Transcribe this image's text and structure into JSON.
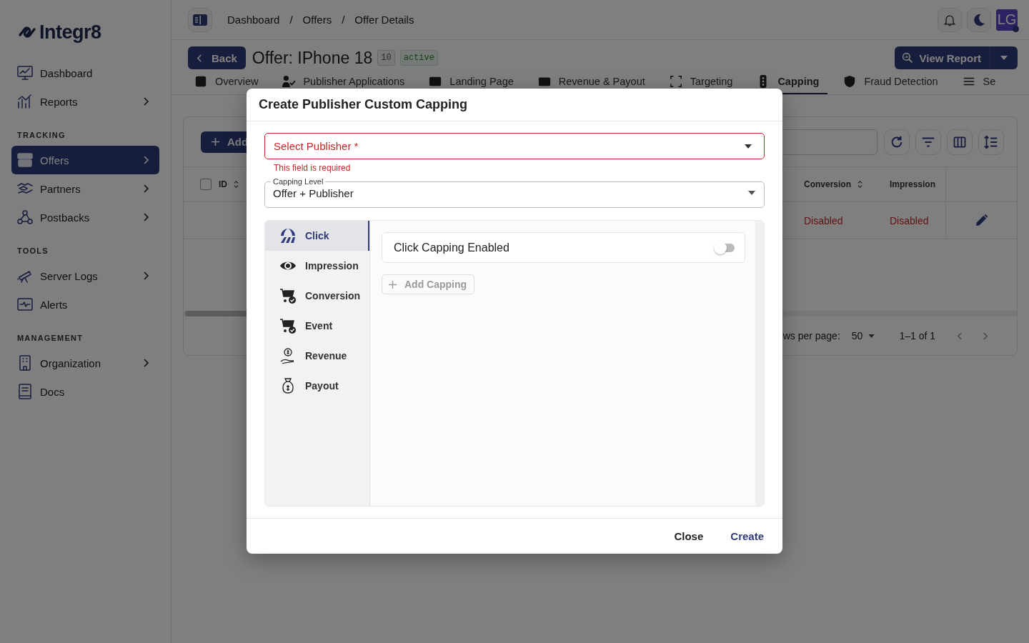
{
  "sidebar": {
    "logo": "Integr8",
    "sections": [
      {
        "items": [
          {
            "label": "Dashboard",
            "expandable": false,
            "selected": false
          },
          {
            "label": "Reports",
            "expandable": true,
            "selected": false
          }
        ]
      },
      {
        "heading": "TRACKING",
        "items": [
          {
            "label": "Offers",
            "expandable": true,
            "selected": true
          },
          {
            "label": "Partners",
            "expandable": true,
            "selected": false
          },
          {
            "label": "Postbacks",
            "expandable": true,
            "selected": false
          }
        ]
      },
      {
        "heading": "TOOLS",
        "items": [
          {
            "label": "Server Logs",
            "expandable": true,
            "selected": false
          },
          {
            "label": "Alerts",
            "expandable": false,
            "selected": false
          }
        ]
      },
      {
        "heading": "MANAGEMENT",
        "items": [
          {
            "label": "Organization",
            "expandable": true,
            "selected": false
          },
          {
            "label": "Docs",
            "expandable": false,
            "selected": false
          }
        ]
      }
    ]
  },
  "breadcrumb": {
    "separator": "/",
    "items": [
      "Dashboard",
      "Offers",
      "Offer Details"
    ]
  },
  "avatar": "LG",
  "header": {
    "back": "Back",
    "title": "Offer: IPhone 18",
    "id": "10",
    "status": "active",
    "view_report": "View Report"
  },
  "tabs": [
    {
      "label": "Overview",
      "selected": false
    },
    {
      "label": "Publisher Applications",
      "selected": false
    },
    {
      "label": "Landing Page",
      "selected": false
    },
    {
      "label": "Revenue & Payout",
      "selected": false
    },
    {
      "label": "Targeting",
      "selected": false
    },
    {
      "label": "Capping",
      "selected": true
    },
    {
      "label": "Fraud Detection",
      "selected": false
    },
    {
      "label": "Se",
      "selected": false
    }
  ],
  "table": {
    "add_button": "Add",
    "all_checked": false,
    "columns": [
      "ID",
      "Conversion",
      "Impression"
    ],
    "rows": [
      {
        "conversion": "Disabled",
        "impression": "Disabled"
      }
    ],
    "footer": {
      "rows_per_page_label": "ws per page:",
      "rows_per_page": "50",
      "range": "1–1 of 1"
    }
  },
  "modal": {
    "title": "Create Publisher Custom Capping",
    "publisher": {
      "label": "Select Publisher *",
      "invalid": true,
      "error": "This field is required"
    },
    "capping_level": {
      "label": "Capping Level",
      "value": "Offer + Publisher"
    },
    "types": [
      {
        "label": "Click",
        "selected": true
      },
      {
        "label": "Impression",
        "selected": false
      },
      {
        "label": "Conversion",
        "selected": false
      },
      {
        "label": "Event",
        "selected": false
      },
      {
        "label": "Revenue",
        "selected": false
      },
      {
        "label": "Payout",
        "selected": false
      }
    ],
    "toggle": {
      "label": "Click Capping Enabled",
      "on": false
    },
    "add_capping": {
      "label": "Add Capping",
      "disabled": true
    },
    "buttons": {
      "close": "Close",
      "create": "Create"
    }
  }
}
